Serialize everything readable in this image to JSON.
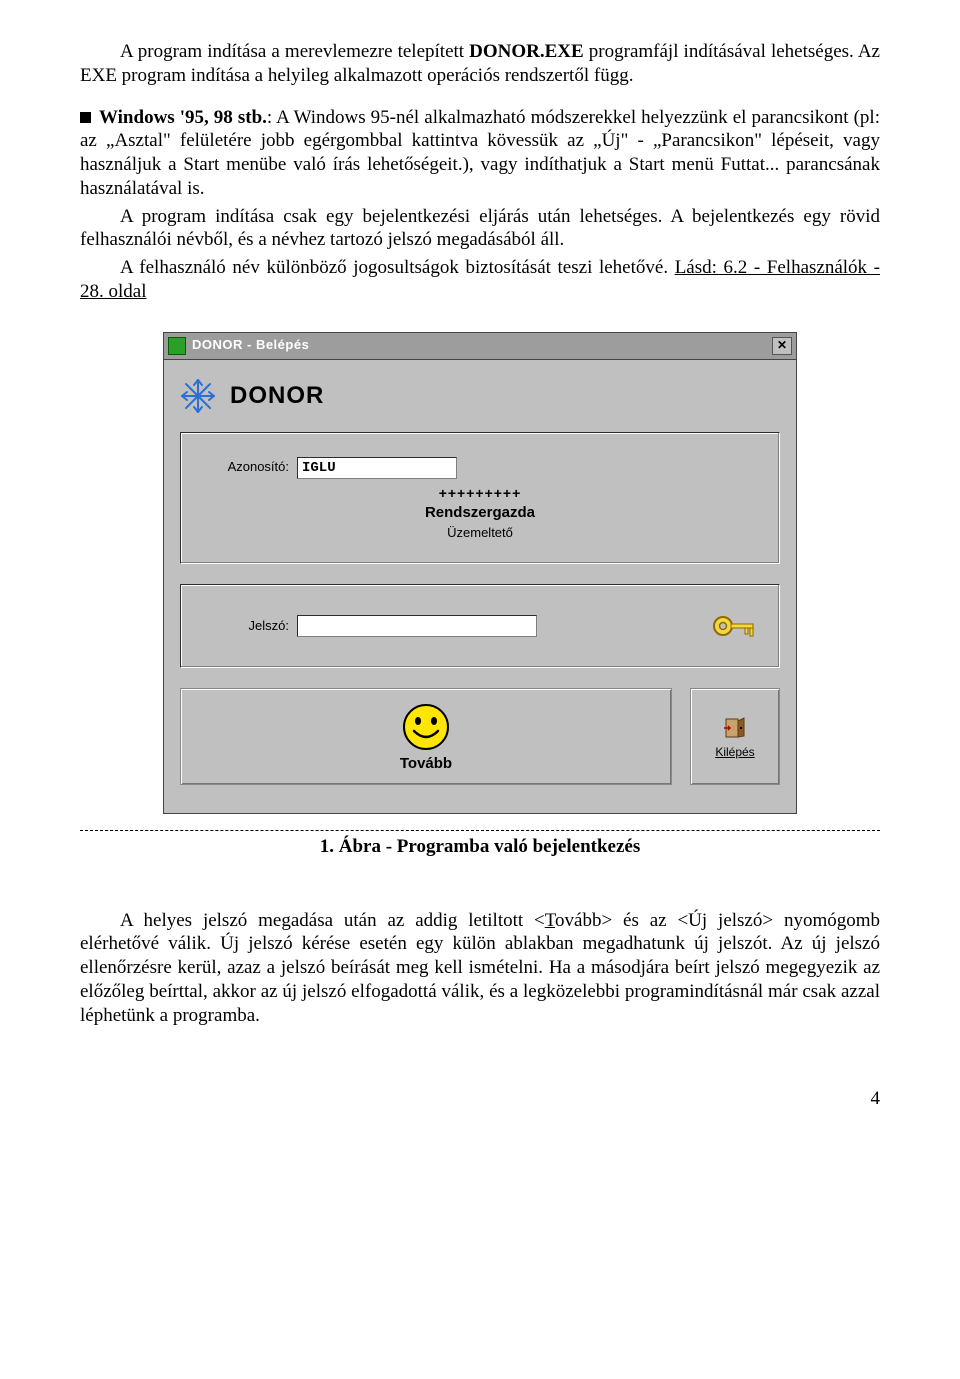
{
  "doc": {
    "p1_a": "A program indítása a merevlemezre telepített ",
    "p1_b": "DONOR.EXE",
    "p1_c": " programfájl indításával lehetséges. Az EXE program indítása a helyileg alkalmazott operációs rendszertől függ.",
    "bullet1": "Windows '95, 98 stb.",
    "bullet1_text": ": A Windows 95-nél alkalmazható módszerekkel helyezzünk el parancsikont (pl: az „Asztal\" felületére jobb egérgombbal kattintva kövessük az „Új\" - „Parancsikon\" lépéseit, vagy használjuk a Start menübe való írás lehetőségeit.), vagy indíthatjuk a Start menü Futtat... parancsának használatával is.",
    "p2": "A program indítása csak egy bejelentkezési eljárás után lehetséges. A bejelentkezés egy rövid felhasználói névből, és a névhez tartozó jelszó megadásából áll.",
    "p3_a": "A felhasználó név különböző jogosultságok biztosítását teszi lehetővé. ",
    "p3_link": "Lásd: 6.2 - Felhasználók - 28. oldal",
    "figure_caption": "1. Ábra - Programba való bejelentkezés",
    "p4": "A helyes jelszó megadása után az addig letiltott <Tovább> és az <Új jelszó> nyomógomb elérhetővé válik. Új jelszó kérése esetén egy külön ablakban megadhatunk új jelszót. Az új jelszó ellenőrzésre kerül, azaz a jelszó beírását meg kell ismételni. Ha a másodjára beírt jelszó megegyezik az előzőleg beírttal, akkor az új jelszó elfogadottá válik, és a legközelebbi programindításnál már csak azzal léphetünk a programba.",
    "p4_t_underline": "T",
    "p4_j_underline": "j",
    "page_number": "4"
  },
  "dialog": {
    "title": "DONOR - Belépés",
    "app_title": "DONOR",
    "azonosito_label": "Azonosító:",
    "azonosito_value": "IGLU",
    "stars": "+++++++++",
    "role_main": "Rendszergazda",
    "role_sub": "Üzemeltető",
    "jelszo_label": "Jelszó:",
    "jelszo_value": "",
    "tovabb": "Tovább",
    "kilepes_k": "K",
    "kilepes_rest": "ilépés"
  }
}
